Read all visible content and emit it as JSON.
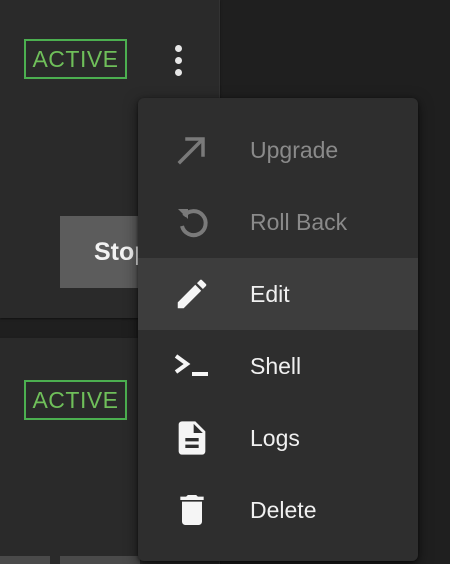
{
  "cards": [
    {
      "status": "ACTIVE",
      "stop_label": "Stop"
    },
    {
      "status": "ACTIVE"
    }
  ],
  "menu": {
    "items": [
      {
        "label": "Upgrade",
        "icon": "upgrade-arrow-icon",
        "disabled": true
      },
      {
        "label": "Roll Back",
        "icon": "rollback-icon",
        "disabled": true
      },
      {
        "label": "Edit",
        "icon": "pencil-icon",
        "highlighted": true
      },
      {
        "label": "Shell",
        "icon": "terminal-icon"
      },
      {
        "label": "Logs",
        "icon": "document-icon"
      },
      {
        "label": "Delete",
        "icon": "trash-icon"
      }
    ]
  },
  "colors": {
    "active_green": "#6fbf5a",
    "menu_bg": "#2e2e2e",
    "highlight_bg": "#3d3d3d",
    "disabled_text": "#8a8a8a"
  }
}
